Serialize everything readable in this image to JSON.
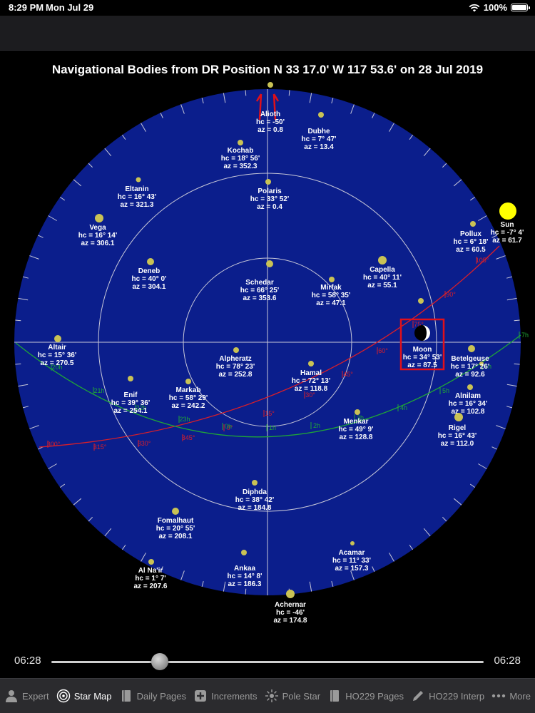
{
  "status": {
    "time": "8:29 PM",
    "date": "Mon Jul 29",
    "battery": "100%"
  },
  "title": "Navigational Bodies from DR Position N 33 17.0' W 117 53.6' on 28 Jul 2019",
  "bodies": [
    {
      "name": "Alioth",
      "hc": "hc = -50'",
      "az": "az = 0.8",
      "kind": "star"
    },
    {
      "name": "Dubhe",
      "hc": "hc = 7° 47'",
      "az": "az = 13.4",
      "kind": "star"
    },
    {
      "name": "Kochab",
      "hc": "hc = 18° 56'",
      "az": "az = 352.3",
      "kind": "star"
    },
    {
      "name": "Eltanin",
      "hc": "hc = 16° 43'",
      "az": "az = 321.3",
      "kind": "star"
    },
    {
      "name": "Polaris",
      "hc": "hc = 33° 52'",
      "az": "az = 0.4",
      "kind": "star"
    },
    {
      "name": "Vega",
      "hc": "hc = 16° 14'",
      "az": "az = 306.1",
      "kind": "star"
    },
    {
      "name": "Pollux",
      "hc": "hc = 6° 18'",
      "az": "az = 60.5",
      "kind": "star"
    },
    {
      "name": "Sun",
      "hc": "hc = -7° 4'",
      "az": "az = 61.7",
      "kind": "sun"
    },
    {
      "name": "Deneb",
      "hc": "hc = 40° 0'",
      "az": "az = 304.1",
      "kind": "star"
    },
    {
      "name": "Capella",
      "hc": "hc = 40° 11'",
      "az": "az = 55.1",
      "kind": "star"
    },
    {
      "name": "Schedar",
      "hc": "hc = 66° 25'",
      "az": "az = 353.6",
      "kind": "star"
    },
    {
      "name": "Mirfak",
      "hc": "hc = 58° 35'",
      "az": "az = 47.1",
      "kind": "star"
    },
    {
      "name": "Moon",
      "hc": "hc = 34° 53'",
      "az": "az = 87.5",
      "kind": "moon"
    },
    {
      "name": "Altair",
      "hc": "hc = 15° 36'",
      "az": "az = 270.5",
      "kind": "star"
    },
    {
      "name": "Betelgeuse",
      "hc": "hc = 17° 26'",
      "az": "az = 92.6",
      "kind": "star"
    },
    {
      "name": "Alpheratz",
      "hc": "hc = 78° 23'",
      "az": "az = 252.8",
      "kind": "star"
    },
    {
      "name": "Hamal",
      "hc": "hc = 72° 13'",
      "az": "az = 118.8",
      "kind": "star"
    },
    {
      "name": "Enif",
      "hc": "hc = 39° 36'",
      "az": "az = 254.1",
      "kind": "star"
    },
    {
      "name": "Markab",
      "hc": "hc = 58° 29'",
      "az": "az = 242.2",
      "kind": "star"
    },
    {
      "name": "Alnilam",
      "hc": "hc = 16° 34'",
      "az": "az = 102.8",
      "kind": "star"
    },
    {
      "name": "Menkar",
      "hc": "hc = 49° 9'",
      "az": "az = 128.8",
      "kind": "star"
    },
    {
      "name": "Rigel",
      "hc": "hc = 16° 43'",
      "az": "az = 112.0",
      "kind": "star"
    },
    {
      "name": "Diphda",
      "hc": "hc = 38° 42'",
      "az": "az = 184.8",
      "kind": "star"
    },
    {
      "name": "Fomalhaut",
      "hc": "hc = 20° 55'",
      "az": "az = 208.1",
      "kind": "star"
    },
    {
      "name": "Acamar",
      "hc": "hc = 11° 33'",
      "az": "az = 157.3",
      "kind": "star"
    },
    {
      "name": "Ankaa",
      "hc": "hc = 14° 8'",
      "az": "az = 186.3",
      "kind": "star"
    },
    {
      "name": "Al Na'ir",
      "hc": "hc = 1° 7'",
      "az": "az = 207.6",
      "kind": "star"
    },
    {
      "name": "Achernar",
      "hc": "hc = -46'",
      "az": "az = 174.8",
      "kind": "star"
    }
  ],
  "ecliptic_labels": [
    "300°",
    "315°",
    "330°",
    "345°",
    "0°",
    "15°",
    "30°",
    "45°",
    "60°",
    "75°",
    "90°",
    "105°"
  ],
  "equator_labels": [
    "20h",
    "21h",
    "22h",
    "23h",
    "0h",
    "1h",
    "2h",
    "3h",
    "4h",
    "5h",
    "6h",
    "7h"
  ],
  "slider": {
    "start": "06:28",
    "end": "06:28",
    "position": 0.25
  },
  "tabs": [
    {
      "label": "Expert",
      "icon": "person-icon",
      "active": false
    },
    {
      "label": "Star Map",
      "icon": "target-icon",
      "active": true
    },
    {
      "label": "Daily Pages",
      "icon": "book-icon",
      "active": false
    },
    {
      "label": "Increments",
      "icon": "plus-icon",
      "active": false
    },
    {
      "label": "Pole Star",
      "icon": "star-burst-icon",
      "active": false
    },
    {
      "label": "HO229 Pages",
      "icon": "book-icon",
      "active": false
    },
    {
      "label": "HO229 Interp",
      "icon": "pencil-icon",
      "active": false
    },
    {
      "label": "More",
      "icon": "ellipsis-icon",
      "active": false
    }
  ],
  "colors": {
    "sky": "#0b1e8c",
    "star": "#c9c255",
    "sun": "#ffff00",
    "ecliptic": "#d81e2a",
    "equator": "#1fa637",
    "highlight": "#e0101a"
  }
}
